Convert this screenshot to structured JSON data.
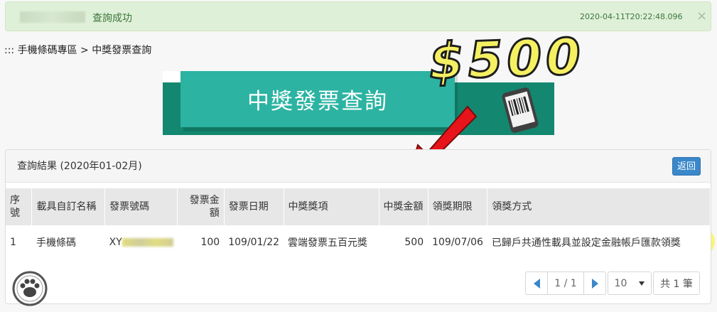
{
  "alert": {
    "message": "查詢成功",
    "timestamp": "2020-04-11T20:22:48.096",
    "close": "×"
  },
  "breadcrumb": "::: 手機條碼專區 > 中獎發票查詢",
  "banner": {
    "title": "中獎發票查詢"
  },
  "annotation": {
    "amount": "$500"
  },
  "panel": {
    "title": "查詢結果 (2020年01-02月)",
    "back_label": "返回"
  },
  "table": {
    "headers": [
      "序號",
      "載具自訂名稱",
      "發票號碼",
      "發票金額",
      "發票日期",
      "中獎獎項",
      "中獎金額",
      "領獎期限",
      "領獎方式"
    ],
    "rows": [
      {
        "index": "1",
        "carrier_name": "手機條碼",
        "invoice_prefix": "XY",
        "invoice_amount": "100",
        "invoice_date": "109/01/22",
        "prize_item": "雲端發票五百元獎",
        "prize_amount": "500",
        "claim_deadline": "109/07/06",
        "claim_method": "已歸戶共通性載具並設定金融帳戶匯款領獎"
      }
    ]
  },
  "pagination": {
    "current": "1 / 1",
    "page_size": "10",
    "total": "共 1 筆"
  },
  "colors": {
    "alert_bg": "#dff0d8",
    "banner": "#2cb3a2",
    "banner_dark": "#13876f",
    "highlight": "#f8f56e",
    "primary": "#3a87c9",
    "arrow": "#e8141b"
  }
}
